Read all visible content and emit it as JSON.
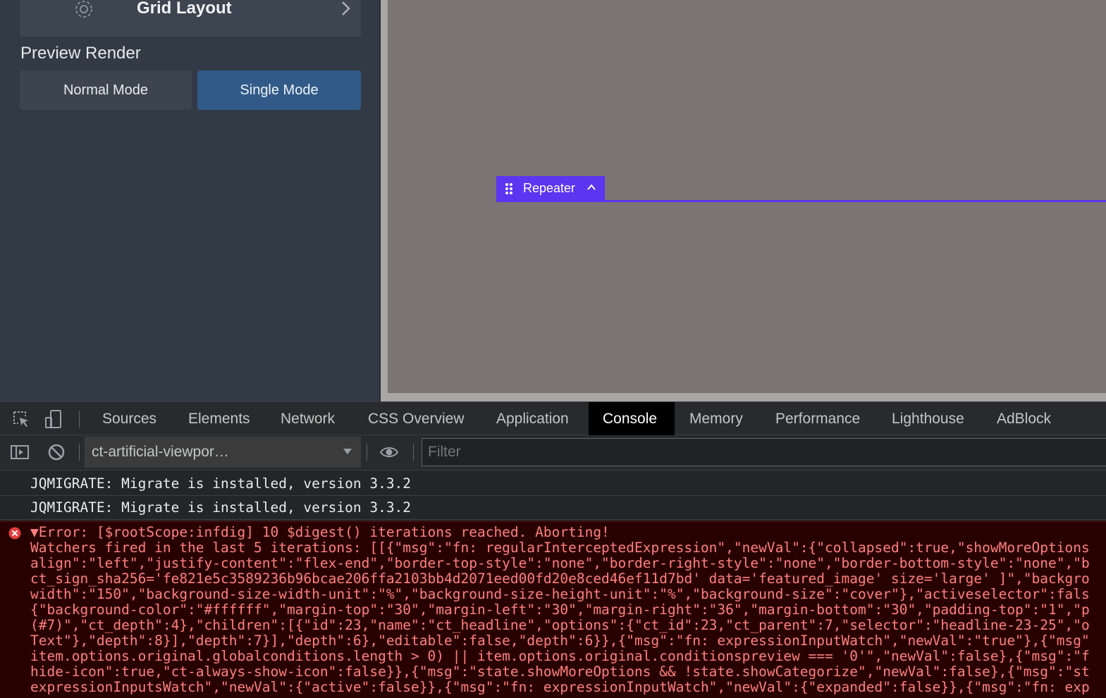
{
  "sidebar": {
    "grid_layout_label": "Grid Layout",
    "preview_render_title": "Preview Render",
    "modes": {
      "normal": "Normal Mode",
      "single": "Single Mode"
    }
  },
  "canvas": {
    "repeater_label": "Repeater",
    "accent_color": "#5b35f0"
  },
  "devtools": {
    "tabs": [
      "Sources",
      "Elements",
      "Network",
      "CSS Overview",
      "Application",
      "Console",
      "Memory",
      "Performance",
      "Lighthouse",
      "AdBlock"
    ],
    "active_tab": "Console",
    "context": "ct-artificial-viewpor…",
    "filter_placeholder": "Filter"
  },
  "console": {
    "logs": [
      "JQMIGRATE: Migrate is installed, version 3.3.2",
      "JQMIGRATE: Migrate is installed, version 3.3.2"
    ],
    "error": {
      "head": "▼Error: [$rootScope:infdig] 10 $digest() iterations reached. Aborting!",
      "lines": [
        "Watchers fired in the last 5 iterations: [[{\"msg\":\"fn: regularInterceptedExpression\",\"newVal\":{\"collapsed\":true,\"showMoreOptions",
        "align\":\"left\",\"justify-content\":\"flex-end\",\"border-top-style\":\"none\",\"border-right-style\":\"none\",\"border-bottom-style\":\"none\",\"b",
        "ct_sign_sha256='fe821e5c3589236b96bcae206ffa2103bb4d2071eed00fd20e8ced46ef11d7bd' data='featured_image' size='large' ]\",\"backgro",
        "width\":\"150\",\"background-size-width-unit\":\"%\",\"background-size-height-unit\":\"%\",\"background-size\":\"cover\"},\"activeselector\":fals",
        "{\"background-color\":\"#ffffff\",\"margin-top\":\"30\",\"margin-left\":\"30\",\"margin-right\":\"36\",\"margin-bottom\":\"30\",\"padding-top\":\"1\",\"p",
        "(#7)\",\"ct_depth\":4},\"children\":[{\"id\":23,\"name\":\"ct_headline\",\"options\":{\"ct_id\":23,\"ct_parent\":7,\"selector\":\"headline-23-25\",\"o",
        "Text\"},\"depth\":8}],\"depth\":7}],\"depth\":6},\"editable\":false,\"depth\":6}},{\"msg\":\"fn: expressionInputWatch\",\"newVal\":\"true\"},{\"msg\"",
        "item.options.original.globalconditions.length > 0) || item.options.original.conditionspreview === '0'\",\"newVal\":false},{\"msg\":\"f",
        "hide-icon\":true,\"ct-always-show-icon\":false}},{\"msg\":\"state.showMoreOptions && !state.showCategorize\",\"newVal\":false},{\"msg\":\"st",
        "expressionInputsWatch\",\"newVal\":{\"active\":false}},{\"msg\":\"fn: expressionInputWatch\",\"newVal\":{\"expanded\":false}},{\"msg\":\"fn: exp"
      ]
    }
  }
}
